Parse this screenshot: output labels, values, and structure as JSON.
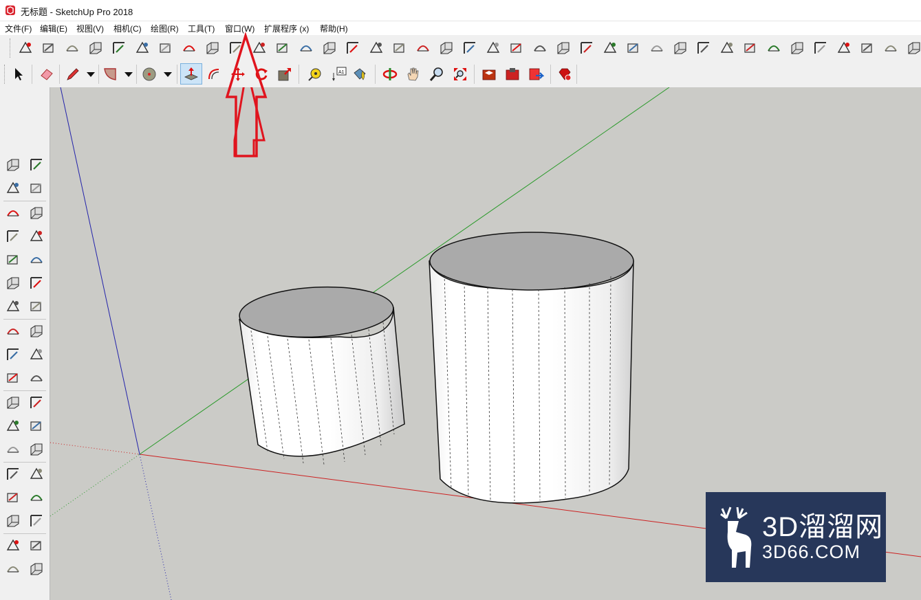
{
  "window": {
    "title": "无标题 - SketchUp Pro 2018"
  },
  "menu": [
    {
      "label": "文件(F)"
    },
    {
      "label": "编辑(E)"
    },
    {
      "label": "视图(V)"
    },
    {
      "label": "相机(C)"
    },
    {
      "label": "绘图(R)"
    },
    {
      "label": "工具(T)"
    },
    {
      "label": "窗口(W)"
    },
    {
      "label": "扩展程序 (x)"
    },
    {
      "label": "帮助(H)"
    }
  ],
  "toolbar_large": {
    "icons": [
      "add-location-icon",
      "section-plane-icon",
      "arc-add-icon",
      "polyline-icon",
      "sandbox-stamp-icon",
      "layers-icon",
      "layers-stack-icon",
      "line-cross-icon",
      "polygon-icon",
      "fold-icon",
      "from-contours-icon",
      "bend-icon",
      "smoove-icon",
      "drape-icon",
      "flip-edge-icon",
      "add-detail-icon",
      "follow-me-icon",
      "corner-icon",
      "offset-corner-icon",
      "line-add-icon",
      "ramp-icon",
      "fence-icon",
      "prism-icon",
      "paint-bucket-icon",
      "columns-icon",
      "balusters-icon",
      "grid-icon",
      "stairs-icon",
      "wall-icon",
      "door-icon",
      "shelves-icon",
      "pin-icon",
      "download-arrow-icon",
      "arrow-cut-icon",
      "bridge-icon",
      "ladder-icon",
      "panel-icon",
      "music-icon",
      "book-icon",
      "window-icon"
    ]
  },
  "toolbar_main": {
    "icons": [
      "select-icon",
      "eraser-icon",
      "pencil-icon",
      "arc-icon",
      "circle-icon",
      "push-pull-icon",
      "offset-icon",
      "move-icon",
      "rotate-icon",
      "scale-icon",
      "tape-measure-icon",
      "text-label-icon",
      "paint-bucket-icon",
      "orbit-icon",
      "pan-icon",
      "zoom-icon",
      "zoom-extents-icon",
      "warehouse-icon",
      "extension-warehouse-icon",
      "send-to-layout-icon",
      "ruby-console-icon"
    ]
  },
  "sidebar": {
    "icons": [
      "select-icon",
      "component-icon",
      "paint-bucket-icon",
      "eraser-icon",
      "pencil-icon",
      "freehand-icon",
      "rectangle-icon",
      "rotated-rectangle-icon",
      "circle-icon",
      "polygon-icon",
      "arc-icon",
      "three-point-arc-icon",
      "pie-icon",
      "two-point-arc-icon",
      "move-icon",
      "push-pull-icon",
      "rotate-icon",
      "follow-me-icon",
      "scale-icon",
      "offset-icon",
      "tape-measure-icon",
      "dimension-icon",
      "protractor-icon",
      "text-label-icon",
      "axes-icon",
      "3d-text-icon",
      "orbit-icon",
      "pan-icon",
      "zoom-icon",
      "zoom-window-icon",
      "zoom-extents-icon",
      "previous-view-icon",
      "position-camera-icon",
      "look-around-icon",
      "walk-icon",
      "section-plane-icon"
    ]
  },
  "colors": {
    "viewport": "#cbcbc7",
    "axis_red": "#cc2020",
    "axis_green": "#2a9a2a",
    "axis_blue": "#2222aa",
    "annotation_arrow": "#e0141e",
    "watermark_bg": "#27375a"
  },
  "watermark": {
    "title": "3D溜溜网",
    "subtitle": "3D66.COM"
  }
}
